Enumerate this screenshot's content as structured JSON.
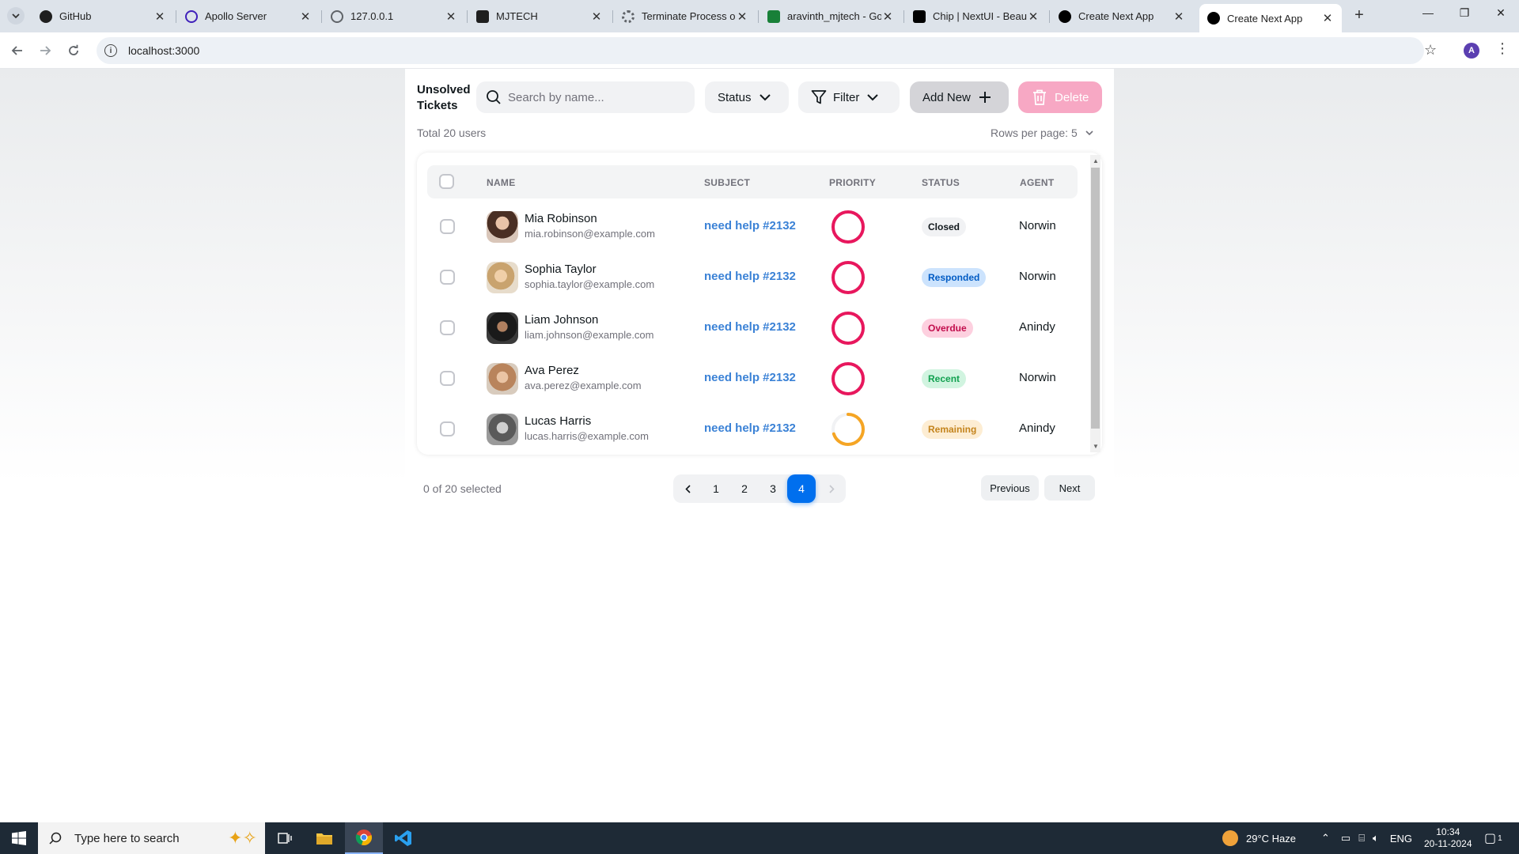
{
  "browser": {
    "tabs": [
      {
        "title": "GitHub",
        "icon": "github-icon",
        "color": "#1f1f1f"
      },
      {
        "title": "Apollo Server",
        "icon": "apollo-icon",
        "color": "#3f20ba"
      },
      {
        "title": "127.0.0.1",
        "icon": "globe-icon",
        "color": "#5f6368"
      },
      {
        "title": "MJTECH",
        "icon": "mjtech-icon",
        "color": "#1f1f1f"
      },
      {
        "title": "Terminate Process on",
        "icon": "gear-icon",
        "color": "#5f6368"
      },
      {
        "title": "aravinth_mjtech - Go",
        "icon": "sheets-icon",
        "color": "#188038"
      },
      {
        "title": "Chip | NextUI - Beaut",
        "icon": "nextui-icon",
        "color": "#000000"
      },
      {
        "title": "Create Next App",
        "icon": "nextjs-icon",
        "color": "#000000"
      },
      {
        "title": "Create Next App",
        "icon": "nextjs-icon",
        "color": "#000000"
      }
    ],
    "url": "localhost:3000",
    "profile_initial": "A"
  },
  "header": {
    "title": "Unsolved Tickets",
    "search_placeholder": "Search by name...",
    "status_label": "Status",
    "filter_label": "Filter",
    "add_label": "Add New",
    "delete_label": "Delete"
  },
  "summary": {
    "total": "Total 20 users",
    "rows_per_page": "Rows per page: 5"
  },
  "table": {
    "columns": [
      "NAME",
      "SUBJECT",
      "PRIORITY",
      "STATUS",
      "AGENT"
    ],
    "rows": [
      {
        "name": "Mia Robinson",
        "email": "mia.robinson@example.com",
        "subject": "need help #2132",
        "priority_fraction": 1.0,
        "priority_color": "#e8175d",
        "status": "Closed",
        "status_bg": "#f1f2f4",
        "status_fg": "#11181c",
        "agent": "Norwin"
      },
      {
        "name": "Sophia Taylor",
        "email": "sophia.taylor@example.com",
        "subject": "need help #2132",
        "priority_fraction": 1.0,
        "priority_color": "#e8175d",
        "status": "Responded",
        "status_bg": "#cce3fd",
        "status_fg": "#005bc4",
        "agent": "Norwin"
      },
      {
        "name": "Liam Johnson",
        "email": "liam.johnson@example.com",
        "subject": "need help #2132",
        "priority_fraction": 1.0,
        "priority_color": "#e8175d",
        "status": "Overdue",
        "status_bg": "#fdd0df",
        "status_fg": "#c20e4d",
        "agent": "Anindy"
      },
      {
        "name": "Ava Perez",
        "email": "ava.perez@example.com",
        "subject": "need help #2132",
        "priority_fraction": 1.0,
        "priority_color": "#e8175d",
        "status": "Recent",
        "status_bg": "#d1f4e0",
        "status_fg": "#12a150",
        "agent": "Norwin"
      },
      {
        "name": "Lucas Harris",
        "email": "lucas.harris@example.com",
        "subject": "need help #2132",
        "priority_fraction": 0.7,
        "priority_color": "#f5a524",
        "status": "Remaining",
        "status_bg": "#fdedd3",
        "status_fg": "#c4841d",
        "agent": "Anindy"
      }
    ]
  },
  "footer": {
    "selected": "0 of 20 selected",
    "pages": [
      "1",
      "2",
      "3",
      "4"
    ],
    "active_page": "4",
    "previous_label": "Previous",
    "next_label": "Next"
  },
  "colors": {
    "accent": "#006fee",
    "danger": "#f7a8c4",
    "link": "#3b82d6"
  },
  "taskbar": {
    "search_text": "Type here to search",
    "weather": "29°C  Haze",
    "language": "ENG",
    "time": "10:34",
    "date": "20-11-2024",
    "notifications": "1"
  }
}
